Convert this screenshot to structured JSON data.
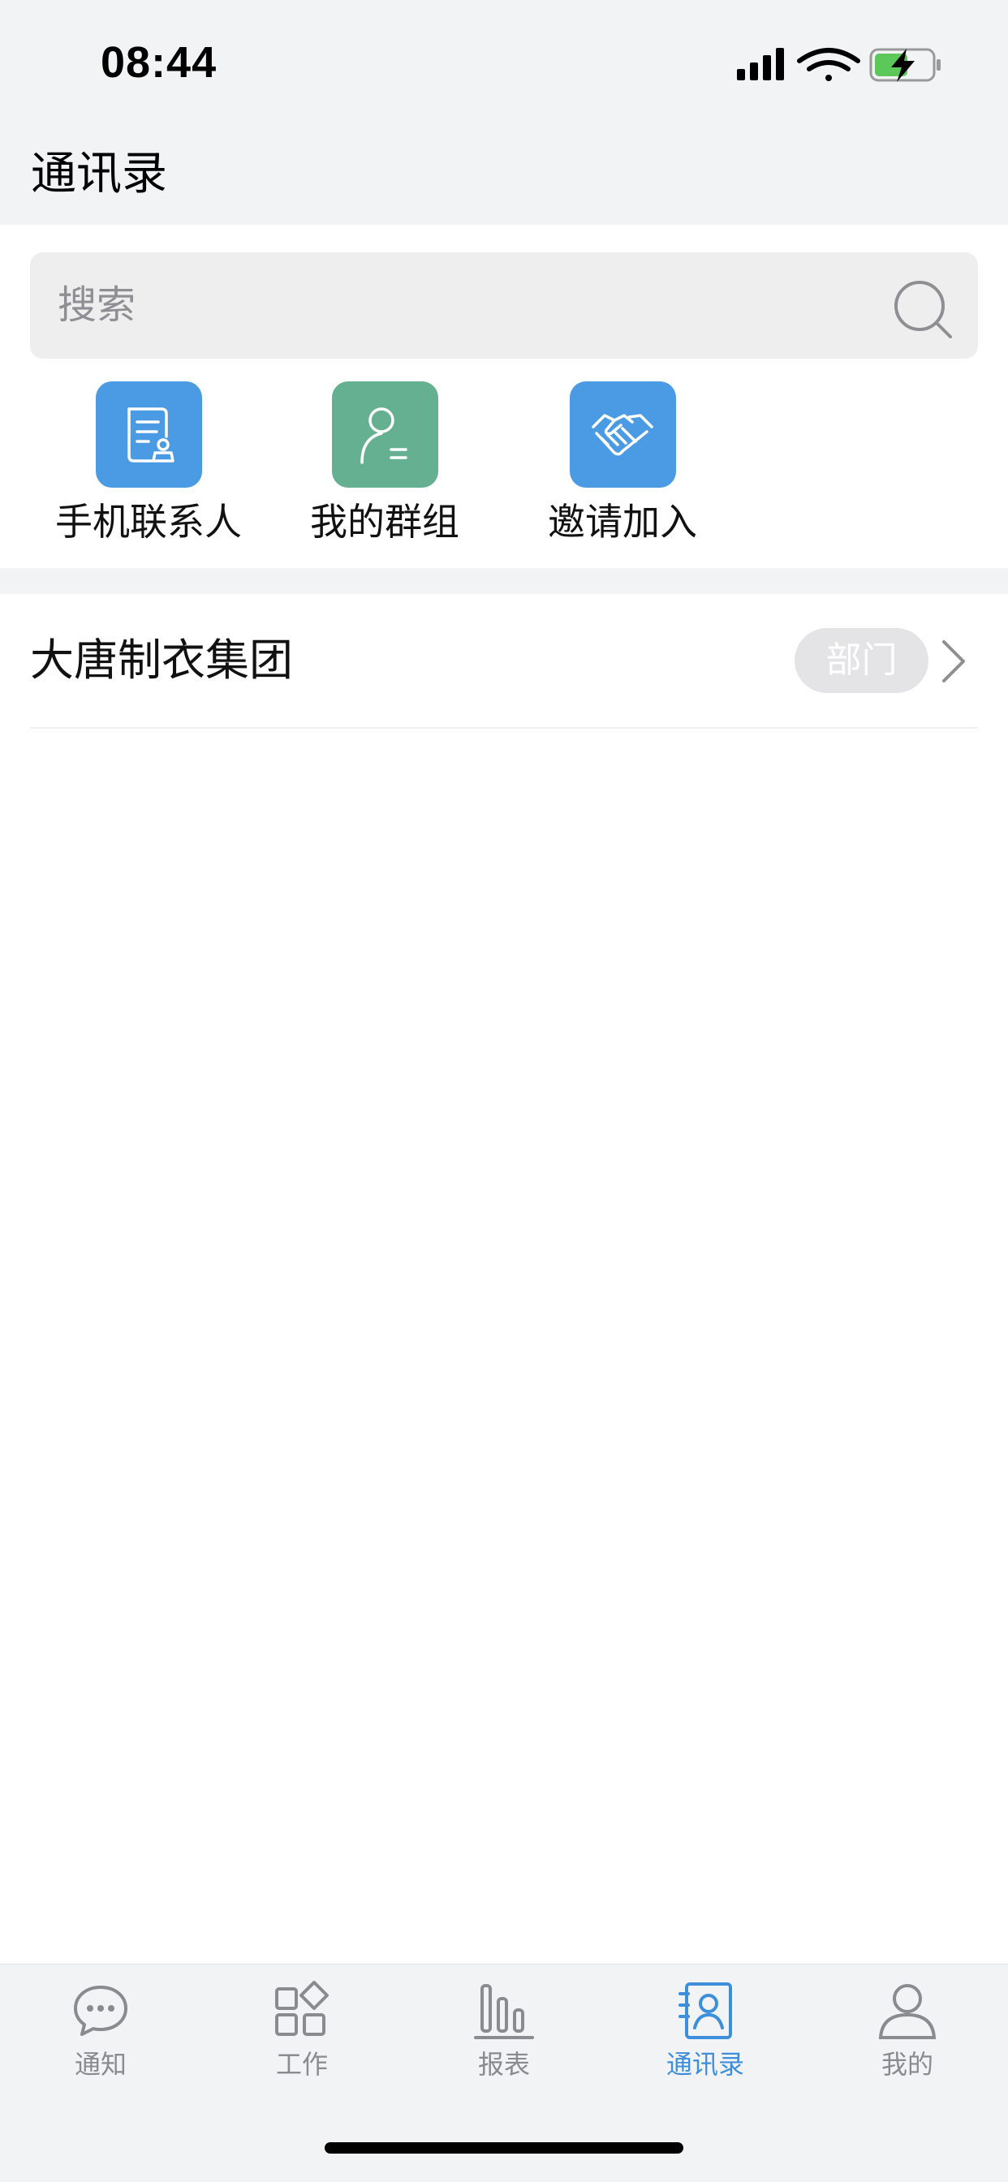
{
  "status_bar": {
    "time": "08:44"
  },
  "header": {
    "title": "通讯录"
  },
  "search": {
    "placeholder": "搜索"
  },
  "quick_actions": [
    {
      "label": "手机联系人",
      "color": "#4a9be3",
      "icon": "contacts-book-icon"
    },
    {
      "label": "我的群组",
      "color": "#66b092",
      "icon": "group-person-icon"
    },
    {
      "label": "邀请加入",
      "color": "#4a9be3",
      "icon": "handshake-icon"
    }
  ],
  "organization": {
    "name": "大唐制衣集团",
    "badge": "部门"
  },
  "tabs": [
    {
      "label": "通知",
      "icon": "chat-bubble-icon",
      "active": false
    },
    {
      "label": "工作",
      "icon": "apps-grid-icon",
      "active": false
    },
    {
      "label": "报表",
      "icon": "bar-chart-icon",
      "active": false
    },
    {
      "label": "通讯录",
      "icon": "address-book-icon",
      "active": true
    },
    {
      "label": "我的",
      "icon": "person-icon",
      "active": false
    }
  ],
  "colors": {
    "accent": "#3e8fdb",
    "header_bg": "#f2f3f5",
    "inactive_tab": "#8a8a8f"
  }
}
